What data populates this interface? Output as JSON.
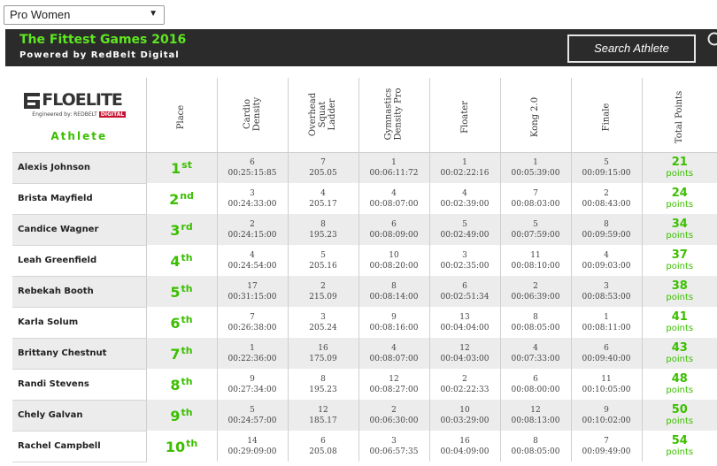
{
  "division": {
    "selected": "Pro Women",
    "caret": "▼"
  },
  "header": {
    "title": "The Fittest Games 2016",
    "subtitle": "Powered by RedBelt Digital",
    "search_label": "Search Athlete"
  },
  "logo": {
    "text": "FLOELITE",
    "tag_prefix": "Engineered by: REDBELT",
    "tag_digital": "DIGITAL"
  },
  "columns": {
    "athlete": "Athlete",
    "place": "Place",
    "events": [
      "Cardio\nDensity",
      "Overhead\nSquat\nLadder",
      "Gymnastics\nDensity Pro",
      "Floater",
      "Kong 2.0",
      "Finale"
    ],
    "total": "Total Points"
  },
  "points_label": "points",
  "rows": [
    {
      "name": "Alexis Johnson",
      "place": "1",
      "suffix": "st",
      "events": [
        [
          "6",
          "00:25:15:85"
        ],
        [
          "7",
          "205.05"
        ],
        [
          "1",
          "00:06:11:72"
        ],
        [
          "1",
          "00:02:22:16"
        ],
        [
          "1",
          "00:05:39:00"
        ],
        [
          "5",
          "00:09:15:00"
        ]
      ],
      "total": "21"
    },
    {
      "name": "Brista Mayfield",
      "place": "2",
      "suffix": "nd",
      "events": [
        [
          "3",
          "00:24:33:00"
        ],
        [
          "4",
          "205.17"
        ],
        [
          "4",
          "00:08:07:00"
        ],
        [
          "4",
          "00:02:39:00"
        ],
        [
          "7",
          "00:08:03:00"
        ],
        [
          "2",
          "00:08:43:00"
        ]
      ],
      "total": "24"
    },
    {
      "name": "Candice Wagner",
      "place": "3",
      "suffix": "rd",
      "events": [
        [
          "2",
          "00:24:15:00"
        ],
        [
          "8",
          "195.23"
        ],
        [
          "6",
          "00:08:09:00"
        ],
        [
          "5",
          "00:02:49:00"
        ],
        [
          "5",
          "00:07:59:00"
        ],
        [
          "8",
          "00:09:59:00"
        ]
      ],
      "total": "34"
    },
    {
      "name": "Leah Greenfield",
      "place": "4",
      "suffix": "th",
      "events": [
        [
          "4",
          "00:24:54:00"
        ],
        [
          "5",
          "205.16"
        ],
        [
          "10",
          "00:08:20:00"
        ],
        [
          "3",
          "00:02:35:00"
        ],
        [
          "11",
          "00:08:10:00"
        ],
        [
          "4",
          "00:09:03:00"
        ]
      ],
      "total": "37"
    },
    {
      "name": "Rebekah Booth",
      "place": "5",
      "suffix": "th",
      "events": [
        [
          "17",
          "00:31:15:00"
        ],
        [
          "2",
          "215.09"
        ],
        [
          "8",
          "00:08:14:00"
        ],
        [
          "6",
          "00:02:51:34"
        ],
        [
          "2",
          "00:06:39:00"
        ],
        [
          "3",
          "00:08:53:00"
        ]
      ],
      "total": "38"
    },
    {
      "name": "Karla Solum",
      "place": "6",
      "suffix": "th",
      "events": [
        [
          "7",
          "00:26:38:00"
        ],
        [
          "3",
          "205.24"
        ],
        [
          "9",
          "00:08:16:00"
        ],
        [
          "13",
          "00:04:04:00"
        ],
        [
          "8",
          "00:08:05:00"
        ],
        [
          "1",
          "00:08:11:00"
        ]
      ],
      "total": "41"
    },
    {
      "name": "Brittany Chestnut",
      "place": "7",
      "suffix": "th",
      "events": [
        [
          "1",
          "00:22:36:00"
        ],
        [
          "16",
          "175.09"
        ],
        [
          "4",
          "00:08:07:00"
        ],
        [
          "12",
          "00:04:03:00"
        ],
        [
          "4",
          "00:07:33:00"
        ],
        [
          "6",
          "00:09:40:00"
        ]
      ],
      "total": "43"
    },
    {
      "name": "Randi Stevens",
      "place": "8",
      "suffix": "th",
      "events": [
        [
          "9",
          "00:27:34:00"
        ],
        [
          "8",
          "195.23"
        ],
        [
          "12",
          "00:08:27:00"
        ],
        [
          "2",
          "00:02:22:33"
        ],
        [
          "6",
          "00:08:00:00"
        ],
        [
          "11",
          "00:10:05:00"
        ]
      ],
      "total": "48"
    },
    {
      "name": "Chely Galvan",
      "place": "9",
      "suffix": "th",
      "events": [
        [
          "5",
          "00:24:57:00"
        ],
        [
          "12",
          "185.17"
        ],
        [
          "2",
          "00:06:30:00"
        ],
        [
          "10",
          "00:03:29:00"
        ],
        [
          "12",
          "00:08:13:00"
        ],
        [
          "9",
          "00:10:02:00"
        ]
      ],
      "total": "50"
    },
    {
      "name": "Rachel Campbell",
      "place": "10",
      "suffix": "th",
      "events": [
        [
          "14",
          "00:29:09:00"
        ],
        [
          "6",
          "205.08"
        ],
        [
          "3",
          "00:06:57:35"
        ],
        [
          "16",
          "00:04:09:00"
        ],
        [
          "8",
          "00:08:05:00"
        ],
        [
          "7",
          "00:09:49:00"
        ]
      ],
      "total": "54"
    }
  ],
  "colors": {
    "accent_green": "#3bbf00",
    "header_green": "#5ee620",
    "header_bg": "#2b2b2b",
    "logo_red": "#c8102e"
  }
}
